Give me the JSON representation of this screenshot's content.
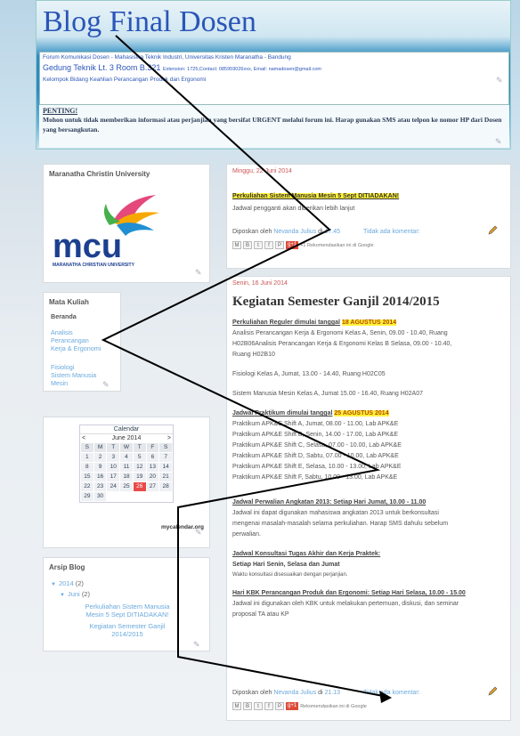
{
  "header": {
    "title": "Blog Final Dosen",
    "desc_line1": "Forum Komunikasi Dosen - Mahasiswa Teknik Industri, Universitas Kristen Maranatha - Bandung",
    "desc_line2": "Gedung Teknik Lt. 3 Room B.321",
    "desc_line2_small": "Extension: 1725,Contact: 085959026xxx, Email: namadosen@gmail.com",
    "desc_line3": "Kelompok Bidang Keahlian Perancangan Produk dan Ergonomi",
    "penting_title": "PENTING!",
    "penting_text": "Mohon untuk tidak memberikan informasi atau perjanjian yang bersifat URGENT melalui forum ini. Harap gunakan SMS atau telpon ke nomor HP dari Dosen yang bersangkutan."
  },
  "sidebar": {
    "university_title": "Maranatha Christin University",
    "logo_text": "mcu",
    "logo_caption": "MARANATHA CHRISTIAN UNIVERSITY",
    "matakuliah_title": "Mata Kuliah",
    "matakuliah_items": [
      "Beranda",
      "Analisis",
      "Perancangan",
      "Kerja & Ergonomi",
      "Fisiologi",
      "Sistem Manusia",
      "Mesin"
    ],
    "calendar": {
      "title": "Calendar",
      "prev": "<",
      "month": "June 2014",
      "next": ">",
      "weekdays": [
        "S",
        "M",
        "T",
        "W",
        "T",
        "F",
        "S"
      ],
      "days": [
        "1",
        "2",
        "3",
        "4",
        "5",
        "6",
        "7",
        "8",
        "9",
        "10",
        "11",
        "12",
        "13",
        "14",
        "15",
        "16",
        "17",
        "18",
        "19",
        "20",
        "21",
        "22",
        "23",
        "24",
        "25",
        "26",
        "27",
        "28",
        "29",
        "30"
      ],
      "today": "26",
      "credit": "mycalendar.org"
    },
    "arsip_title": "Arsip Blog",
    "arsip_year": "2014",
    "arsip_year_count": "(2)",
    "arsip_month": "Juni",
    "arsip_month_count": "(2)",
    "arsip_posts": [
      [
        "Perkuliahan Sistem Manusia",
        "Mesin 5 Sept DITIADAKAN!"
      ],
      [
        "Kegiatan Semester Ganjil",
        "2014/2015"
      ]
    ]
  },
  "post1": {
    "date": "Minggu, 22 Juni 2014",
    "headline": "Perkuliahan Sistem Manusia Mesin 5 Sept DITIADAKAN!",
    "text": "Jadwal pengganti akan diberikan lebih lanjut",
    "posted_by": "Diposkan oleh",
    "author": "Nevanda Julius",
    "at": "di",
    "time": "17.45",
    "comments": "Tidak ada komentar:",
    "recommend": "+1 Rekomendasikan ini di Google"
  },
  "post2": {
    "date": "Senin, 16 Juni 2014",
    "title": "Kegiatan Semester Ganjil 2014/2015",
    "reguler_head": "Perkuliahan Reguler dimulai tanggal",
    "reguler_date": "18 AGUSTUS 2014",
    "reguler_lines": [
      "Analisis Perancangan Kerja & Ergonomi Kelas A, Senin, 09.00 - 10.40, Ruang",
      "H02B06Analisis Perancangan Kerja & Ergonomi Kelas B Selasa, 09.00 - 10.40,",
      "Ruang H02B10"
    ],
    "fisiologi_line": "Fisiologi Kelas A, Jumat, 13.00 - 14.40, Ruang H02C05",
    "sistem_line": "Sistem Manusia Mesin Kelas A, Jumat 15.00 - 16.40, Ruang H02A07",
    "praktikum_head": "Jadwal Praktikum dimulai tanggal",
    "praktikum_date": "25 AGUSTUS 2014",
    "praktikum_lines": [
      "Praktikum APK&E Shift A, Jumat, 08.00 - 11.00, Lab APK&E",
      "Praktikum APK&E Shift B, Senin, 14.00 - 17.00, Lab APK&E",
      "Praktikum APK&E Shift C, Selasa, 07.00 - 10.00, Lab APK&E",
      "Praktikum APK&E Shift D, Sabtu, 07.00 - 10.00, Lab APK&E",
      "Praktikum APK&E Shift E, Selasa, 10.00 - 13.00, Lab APK&E",
      "Praktikum APK&E Shift F, Sabtu, 10.00 - 13.00, Lab APK&E"
    ],
    "perwalian_head": "Jadwal Perwalian Angkatan 2013: Setiap Hari Jumat, 10.00 - 11.00",
    "perwalian_lines": [
      "Jadwal ini dapat digunakan mahasiswa angkatan 2013 untuk berkonsultasi",
      "mengenai masalah-masalah selama perkuliahan. Harap SMS dahulu sebelum",
      "perwalian."
    ],
    "konsultasi_head": "Jadwal Konsultasi Tugas Akhir dan Kerja Praktek:",
    "konsultasi_days": "Setiap Hari Senin, Selasa dan Jumat",
    "konsultasi_note": "Waktu konsultasi disesuaikan dengan perjanjian.",
    "kbk_head": "Hari KBK Perancangan Produk dan Ergonomi: Setiap Hari Selasa, 10.00 - 15.00",
    "kbk_lines": [
      "Jadwal ini digunakan oleh KBK untuk melakukan pertemuan, diskusi, dan seminar",
      "proposal TA atau KP"
    ],
    "posted_by": "Diposkan oleh",
    "author": "Nevanda Julius",
    "at": "di",
    "time": "21.13",
    "comments": "Tidak ada komentar:",
    "recommend": "Rekomendasikan ini di Google"
  },
  "colors": {
    "title_blue": "#2a55b8",
    "link_blue": "#6aa9dd",
    "date_red": "#cc5555",
    "highlight": "#fff23a",
    "today_red": "#e84a4a"
  }
}
